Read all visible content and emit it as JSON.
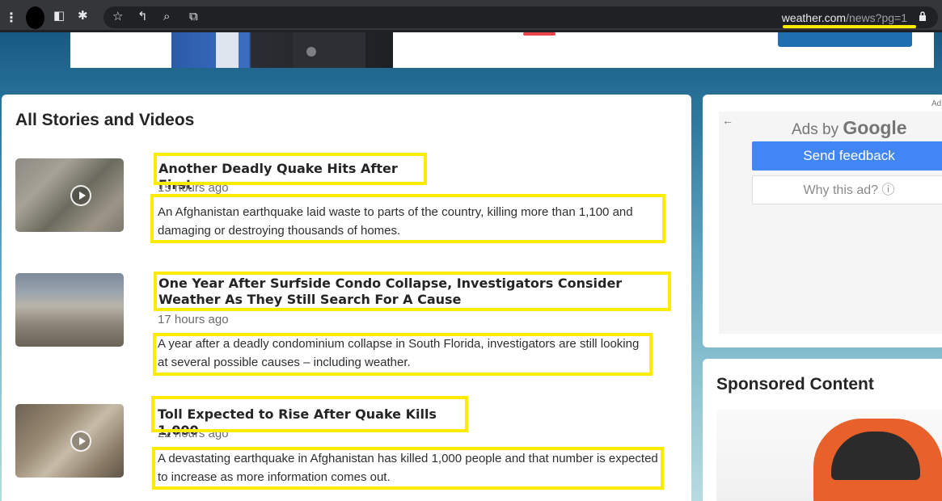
{
  "browser": {
    "url_domain": "weather.com",
    "url_path": "/news?pg=1",
    "icons": [
      "menu-dots-icon",
      "profile-icon",
      "sidebar-icon",
      "extensions-icon",
      "bookmark-star-icon",
      "share-icon",
      "search-zoom-icon",
      "cast-icon",
      "lock-icon"
    ]
  },
  "main": {
    "title": "All Stories and Videos",
    "stories": [
      {
        "headline": "Another Deadly Quake Hits After First",
        "time": "15 hours ago",
        "description": "An Afghanistan earthquake laid waste to parts of the country, killing more than 1,100 and damaging or destroying thousands of homes.",
        "has_video": true
      },
      {
        "headline": "One Year After Surfside Condo Collapse, Investigators Consider Weather As They Still Search For A Cause",
        "time": "17 hours ago",
        "description": "A year after a deadly condominium collapse in South Florida, investigators are still looking at several possible causes – including weather.",
        "has_video": false
      },
      {
        "headline": "Toll Expected to Rise After Quake Kills 1,000",
        "time": "22 hours ago",
        "description": "A devastating earthquake in Afghanistan has killed 1,000 people and that number is expected to increase as more information comes out.",
        "has_video": true
      }
    ]
  },
  "ad": {
    "marker": "Ad",
    "ads_by": "Ads by",
    "google": "Google",
    "send_feedback": "Send feedback",
    "why_this_ad": "Why this ad? ⓘ"
  },
  "sponsored": {
    "title": "Sponsored Content"
  },
  "colors": {
    "highlight": "#ffeb00",
    "feedback_button": "#4285f4",
    "page_bg_top": "#0f4f78"
  }
}
